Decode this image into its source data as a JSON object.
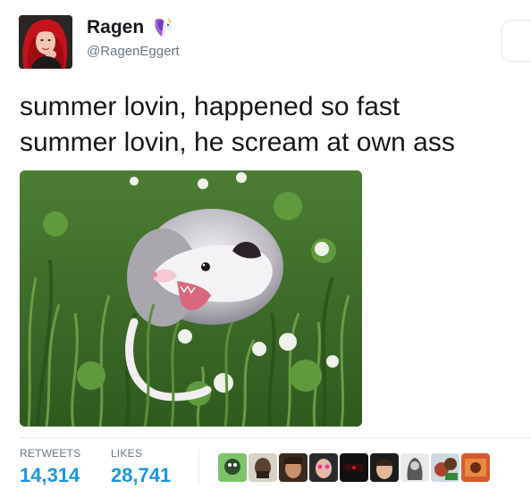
{
  "tweet": {
    "display_name": "Ragen",
    "handle": "@RagenEggert",
    "text_lines": [
      "summer lovin, happened so fast",
      "summer lovin, he scream at own ass"
    ],
    "stats": {
      "retweets_label": "RETWEETS",
      "retweets_value": "14,314",
      "likes_label": "LIKES",
      "likes_value": "28,741"
    },
    "colors": {
      "link_blue": "#1b95e0",
      "secondary_gray": "#657786",
      "text": "#14171a"
    },
    "icons": {
      "name_badge": "unicorn-icon"
    }
  }
}
